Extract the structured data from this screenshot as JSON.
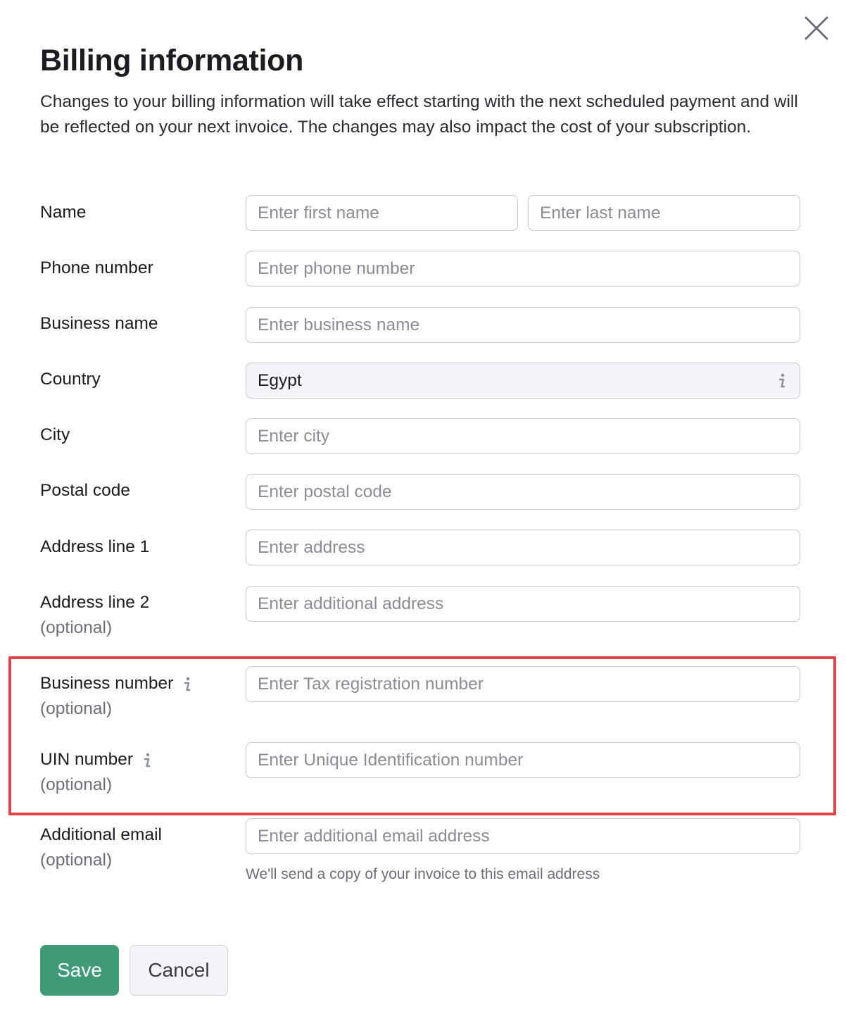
{
  "dialog": {
    "title": "Billing information",
    "description": "Changes to your billing information will take effect starting with the next scheduled payment and will be reflected on your next invoice. The changes may also impact the cost of your subscription."
  },
  "fields": {
    "name": {
      "label": "Name",
      "first_placeholder": "Enter first name",
      "last_placeholder": "Enter last name"
    },
    "phone": {
      "label": "Phone number",
      "placeholder": "Enter phone number"
    },
    "business_name": {
      "label": "Business name",
      "placeholder": "Enter business name"
    },
    "country": {
      "label": "Country",
      "value": "Egypt"
    },
    "city": {
      "label": "City",
      "placeholder": "Enter city"
    },
    "postal_code": {
      "label": "Postal code",
      "placeholder": "Enter postal code"
    },
    "address1": {
      "label": "Address line 1",
      "placeholder": "Enter address"
    },
    "address2": {
      "label": "Address line 2",
      "optional": "(optional)",
      "placeholder": "Enter additional address"
    },
    "business_number": {
      "label": "Business number",
      "optional": "(optional)",
      "placeholder": "Enter Tax registration number"
    },
    "uin_number": {
      "label": "UIN number",
      "optional": "(optional)",
      "placeholder": "Enter Unique Identification number"
    },
    "additional_email": {
      "label": "Additional email",
      "optional": "(optional)",
      "placeholder": "Enter additional email address",
      "hint": "We'll send a copy of your invoice to this email address"
    }
  },
  "buttons": {
    "save": "Save",
    "cancel": "Cancel"
  },
  "icons": {
    "close": "close-icon",
    "info": "info-icon"
  },
  "colors": {
    "primary": "#3f9a78",
    "highlight": "#e04545"
  }
}
